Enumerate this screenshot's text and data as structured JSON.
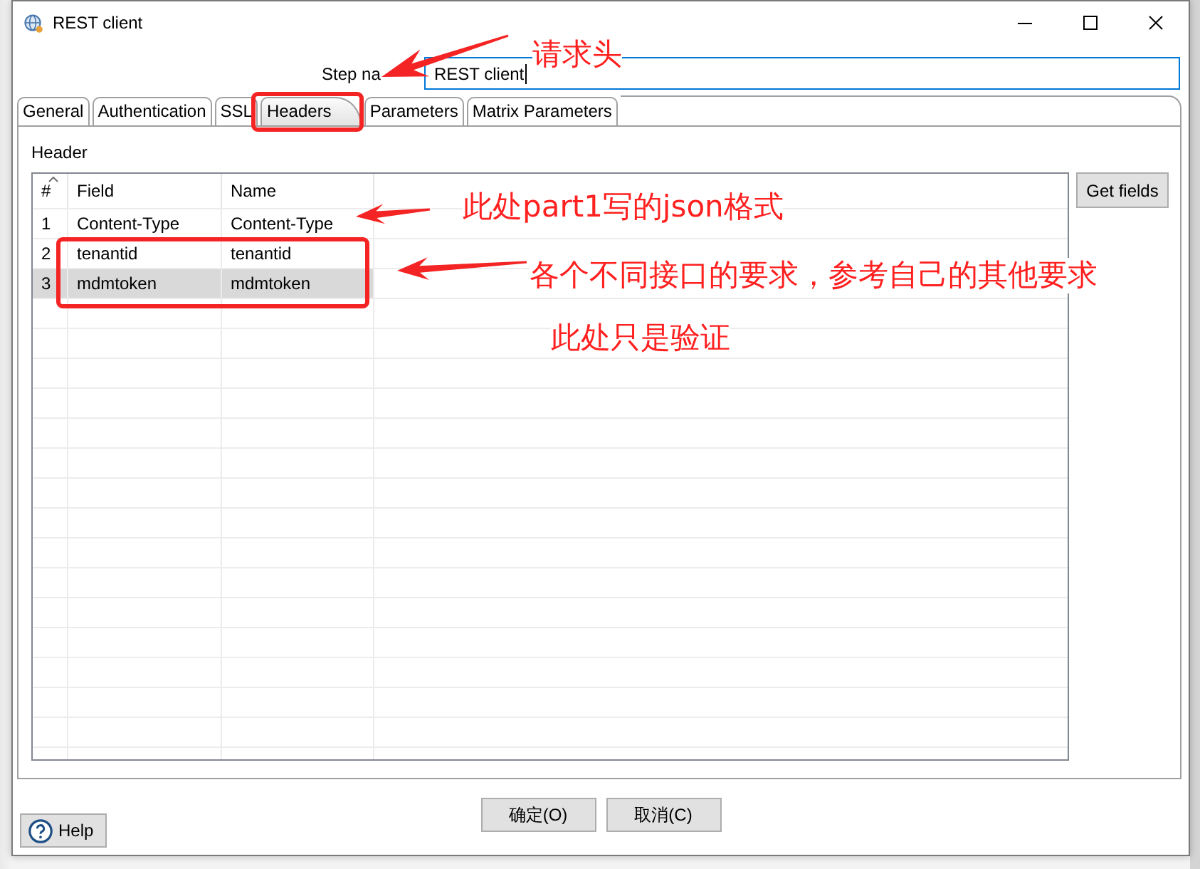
{
  "window": {
    "title": "REST client"
  },
  "step_name": {
    "label": "Step na",
    "value": "REST client",
    "focused": true
  },
  "tabs": [
    {
      "label": "General",
      "selected": false
    },
    {
      "label": "Authentication",
      "selected": false
    },
    {
      "label": "SSL",
      "selected": false
    },
    {
      "label": "Headers",
      "selected": true
    },
    {
      "label": "Parameters",
      "selected": false
    },
    {
      "label": "Matrix Parameters",
      "selected": false
    }
  ],
  "headers_tab": {
    "section_label": "Header",
    "get_fields_button": "Get fields"
  },
  "table": {
    "columns": [
      {
        "label": "#",
        "sorted": true
      },
      {
        "label": "Field",
        "sorted": false
      },
      {
        "label": "Name",
        "sorted": false
      }
    ],
    "rows": [
      {
        "number": "1",
        "field": "Content-Type",
        "name": "Content-Type",
        "selected": false
      },
      {
        "number": "2",
        "field": "tenantid",
        "name": "tenantid",
        "selected": false
      },
      {
        "number": "3",
        "field": "mdmtoken",
        "name": "mdmtoken",
        "selected": true
      }
    ]
  },
  "buttons": [
    {
      "label": "确定(O)"
    },
    {
      "label": "取消(C)"
    }
  ],
  "help_button": {
    "label": "Help"
  },
  "annotations": [
    {
      "text": "请求头"
    },
    {
      "text": "此处part1写的json格式"
    },
    {
      "text": "各个不同接口的要求，参考自己的其他要求"
    },
    {
      "text": "此处只是验证"
    }
  ]
}
